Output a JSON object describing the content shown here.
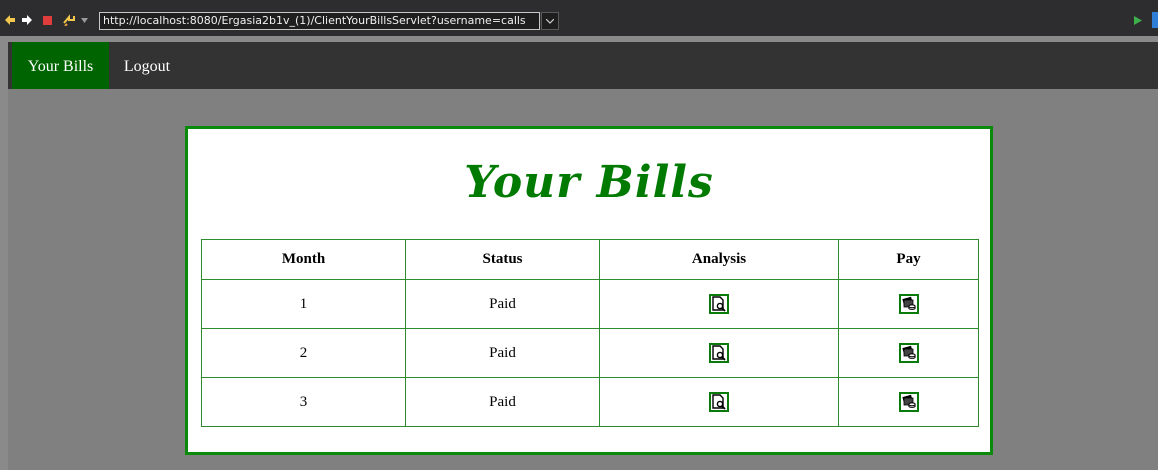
{
  "browser": {
    "url": "http://localhost:8080/Ergasia2b1v_(1)/ClientYourBillsServlet?username=calls",
    "icons": [
      "back-arrow-icon",
      "forward-arrow-icon",
      "stop-icon",
      "refresh-icon",
      "dropdown-chevron-icon",
      "go-play-icon"
    ]
  },
  "nav": {
    "items": [
      {
        "label": "Your Bills",
        "active": true
      },
      {
        "label": "Logout",
        "active": false
      }
    ]
  },
  "page": {
    "title": "Your Bills"
  },
  "table": {
    "headers": [
      "Month",
      "Status",
      "Analysis",
      "Pay"
    ],
    "rows": [
      {
        "month": "1",
        "status": "Paid"
      },
      {
        "month": "2",
        "status": "Paid"
      },
      {
        "month": "3",
        "status": "Paid"
      }
    ]
  },
  "colors": {
    "accent_green": "#006400",
    "border_green": "#0a8a0a",
    "title_green": "#007a00",
    "nav_bg": "#333333",
    "page_bg": "#808080"
  }
}
